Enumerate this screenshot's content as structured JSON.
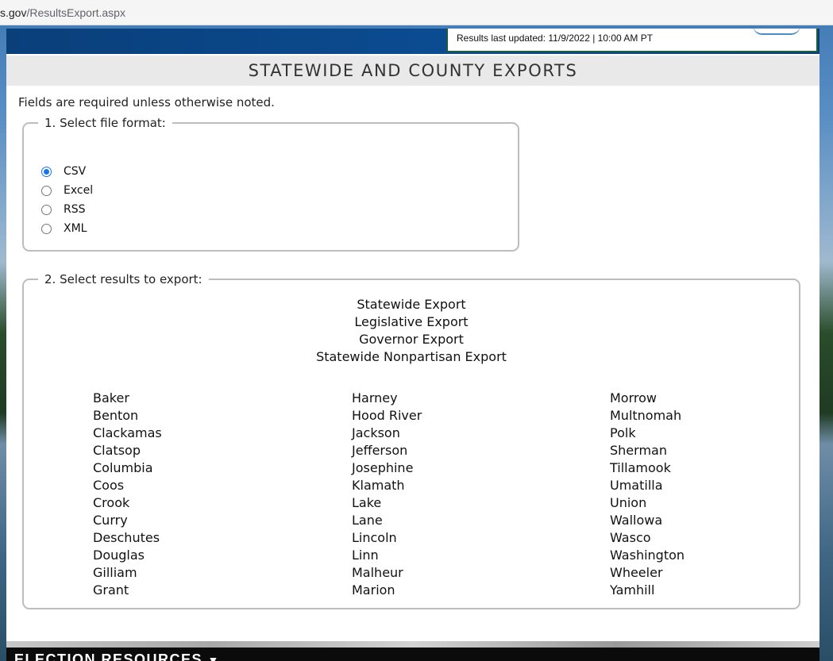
{
  "browser": {
    "url_host": "s.gov",
    "url_path": "/ResultsExport.aspx"
  },
  "header": {
    "last_updated": "Results last updated: 11/9/2022 | 10:00 AM PT"
  },
  "page": {
    "title": "STATEWIDE AND COUNTY EXPORTS",
    "required_note": "Fields are required unless otherwise noted."
  },
  "format_section": {
    "legend": "1. Select file format:",
    "options": [
      "CSV",
      "Excel",
      "RSS",
      "XML"
    ],
    "selected": "CSV"
  },
  "results_section": {
    "legend": "2. Select results to export:",
    "exports": [
      "Statewide Export",
      "Legislative Export",
      "Governor Export",
      "Statewide Nonpartisan Export"
    ],
    "counties_col1": [
      "Baker",
      "Benton",
      "Clackamas",
      "Clatsop",
      "Columbia",
      "Coos",
      "Crook",
      "Curry",
      "Deschutes",
      "Douglas",
      "Gilliam",
      "Grant"
    ],
    "counties_col2": [
      "Harney",
      "Hood River",
      "Jackson",
      "Jefferson",
      "Josephine",
      "Klamath",
      "Lake",
      "Lane",
      "Lincoln",
      "Linn",
      "Malheur",
      "Marion"
    ],
    "counties_col3": [
      "Morrow",
      "Multnomah",
      "Polk",
      "Sherman",
      "Tillamook",
      "Umatilla",
      "Union",
      "Wallowa",
      "Wasco",
      "Washington",
      "Wheeler",
      "Yamhill"
    ]
  },
  "footer": {
    "label": "ELECTION RESOURCES",
    "chevron_icon": "chevron-down-icon"
  },
  "colors": {
    "banner_blue": "#0b4d94",
    "radio_selected": "#1a73e8",
    "title_bar_bg": "#e9e9e9"
  }
}
